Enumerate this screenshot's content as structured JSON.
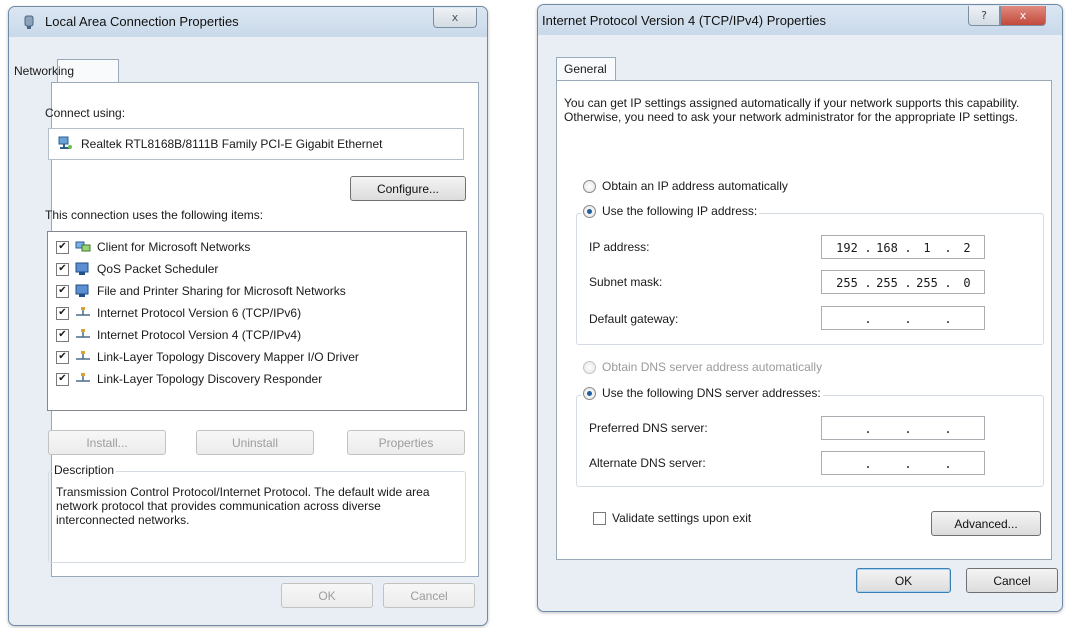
{
  "left_window": {
    "title": "Local Area Connection Properties",
    "tab": "Networking",
    "connect_using_label": "Connect using:",
    "adapter_name": "Realtek RTL8168B/8111B Family PCI-E Gigabit Ethernet",
    "configure_label": "Configure...",
    "items_label": "This connection uses the following items:",
    "items": [
      {
        "label": "Client for Microsoft Networks",
        "checked": true,
        "icon": "network-client-icon"
      },
      {
        "label": "QoS Packet Scheduler",
        "checked": true,
        "icon": "service-icon"
      },
      {
        "label": "File and Printer Sharing for Microsoft Networks",
        "checked": true,
        "icon": "service-icon"
      },
      {
        "label": "Internet Protocol Version 6 (TCP/IPv6)",
        "checked": true,
        "icon": "protocol-icon"
      },
      {
        "label": "Internet Protocol Version 4 (TCP/IPv4)",
        "checked": true,
        "icon": "protocol-icon"
      },
      {
        "label": "Link-Layer Topology Discovery Mapper I/O Driver",
        "checked": true,
        "icon": "protocol-icon"
      },
      {
        "label": "Link-Layer Topology Discovery Responder",
        "checked": true,
        "icon": "protocol-icon"
      }
    ],
    "install_label": "Install...",
    "uninstall_label": "Uninstall",
    "properties_label": "Properties",
    "description_label": "Description",
    "description_text": "Transmission Control Protocol/Internet Protocol. The default wide area network protocol that provides communication across diverse interconnected networks.",
    "ok_label": "OK",
    "cancel_label": "Cancel"
  },
  "right_window": {
    "title": "Internet Protocol Version 4 (TCP/IPv4) Properties",
    "tab": "General",
    "intro_text": "You can get IP settings assigned automatically if your network supports this capability. Otherwise, you need to ask your network administrator for the appropriate IP settings.",
    "obtain_ip_auto_label": "Obtain an IP address automatically",
    "use_following_ip_label": "Use the following IP address:",
    "ip_address_label": "IP address:",
    "ip_address": [
      "192",
      "168",
      "1",
      "2"
    ],
    "subnet_mask_label": "Subnet mask:",
    "subnet_mask": [
      "255",
      "255",
      "255",
      "0"
    ],
    "default_gateway_label": "Default gateway:",
    "obtain_dns_auto_label": "Obtain DNS server address automatically",
    "use_following_dns_label": "Use the following DNS server addresses:",
    "preferred_dns_label": "Preferred DNS server:",
    "alternate_dns_label": "Alternate DNS server:",
    "validate_label": "Validate settings upon exit",
    "advanced_label": "Advanced...",
    "ok_label": "OK",
    "cancel_label": "Cancel",
    "help_glyph": "?",
    "close_glyph": "x"
  }
}
